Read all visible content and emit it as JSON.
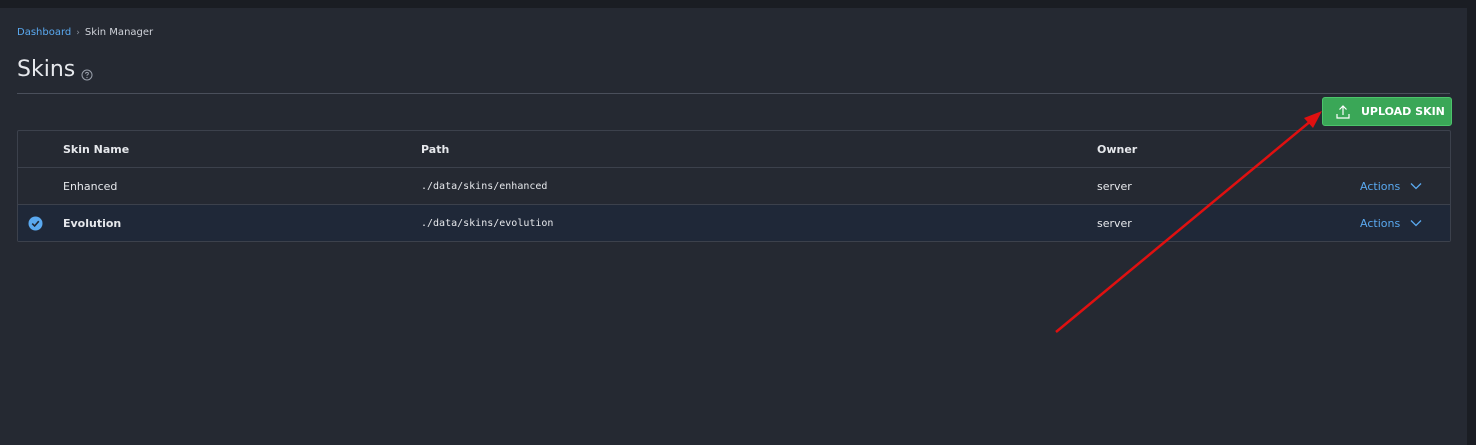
{
  "breadcrumb": {
    "parent": "Dashboard",
    "current": "Skin Manager"
  },
  "page": {
    "title": "Skins"
  },
  "toolbar": {
    "upload_label": "UPLOAD SKIN"
  },
  "table": {
    "columns": [
      "Skin Name",
      "Path",
      "Owner"
    ],
    "rows": [
      {
        "name": "Enhanced",
        "path": "./data/skins/enhanced",
        "owner": "server",
        "actions": "Actions",
        "selected": false
      },
      {
        "name": "Evolution",
        "path": "./data/skins/evolution",
        "owner": "server",
        "actions": "Actions",
        "selected": true
      }
    ]
  },
  "colors": {
    "accent": "#5aa9f0",
    "upload_button": "#3aa757",
    "annotation_arrow": "#e01010"
  },
  "icons": [
    "help-icon",
    "upload-icon",
    "check-circle-icon",
    "chevron-down-icon"
  ]
}
